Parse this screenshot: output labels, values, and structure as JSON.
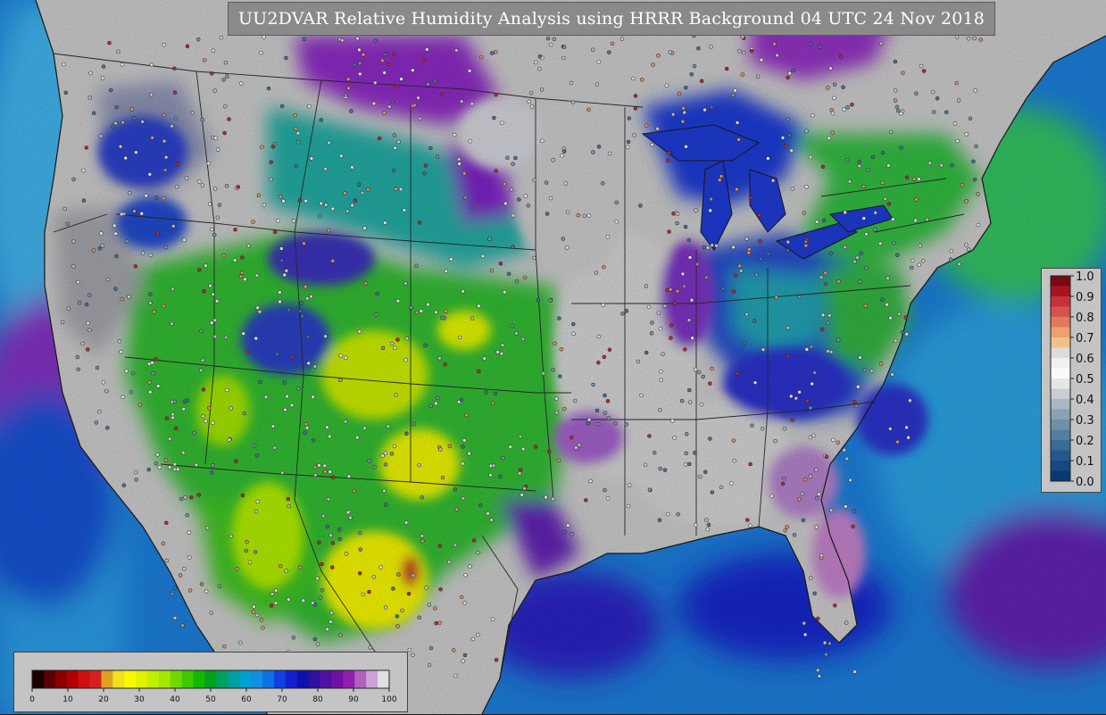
{
  "title": "UU2DVAR Relative Humidity Analysis using HRRR Background 04 UTC 24 Nov 2018",
  "obs_colorbar": {
    "ticks": [
      "1.0",
      "0.9",
      "0.8",
      "0.7",
      "0.6",
      "0.5",
      "0.4",
      "0.3",
      "0.2",
      "0.1",
      "0.0"
    ],
    "colors_top_to_bottom": [
      "#7a0a12",
      "#a8141e",
      "#c5323a",
      "#d4544c",
      "#e07a5c",
      "#eda070",
      "#f2c08a",
      "#dcdcdc",
      "#f0f0f0",
      "#fafafa",
      "#e6e6e6",
      "#c8ced4",
      "#a8b8c4",
      "#8aa2b4",
      "#6e90a8",
      "#527ea0",
      "#3a6c98",
      "#24588c",
      "#144880",
      "#0a3870"
    ]
  },
  "grid_colorbar": {
    "ticks": [
      "0",
      "10",
      "20",
      "30",
      "40",
      "50",
      "60",
      "70",
      "80",
      "90",
      "100"
    ],
    "colors": [
      "#1a0000",
      "#5a0000",
      "#8a0000",
      "#b00000",
      "#cc1010",
      "#d42020",
      "#e0a020",
      "#f0e020",
      "#f8f800",
      "#e0f000",
      "#c0f000",
      "#a0e800",
      "#70d800",
      "#40c800",
      "#10b800",
      "#00a020",
      "#00a060",
      "#00a0a0",
      "#00a0d0",
      "#1090e0",
      "#1070e8",
      "#1040e0",
      "#1020d0",
      "#1010b0",
      "#3010a0",
      "#5010a0",
      "#7010a0",
      "#9020b0",
      "#b060c0",
      "#d0a0d8",
      "#e0e0e0"
    ]
  },
  "palette": {
    "ocean": "#1c7cd6",
    "gray": "#c8c8c8",
    "purple": "#8a20c0",
    "blue": "#1a2cd0",
    "green": "#30c030",
    "yellow": "#f0f000",
    "teal": "#20b0b0"
  }
}
